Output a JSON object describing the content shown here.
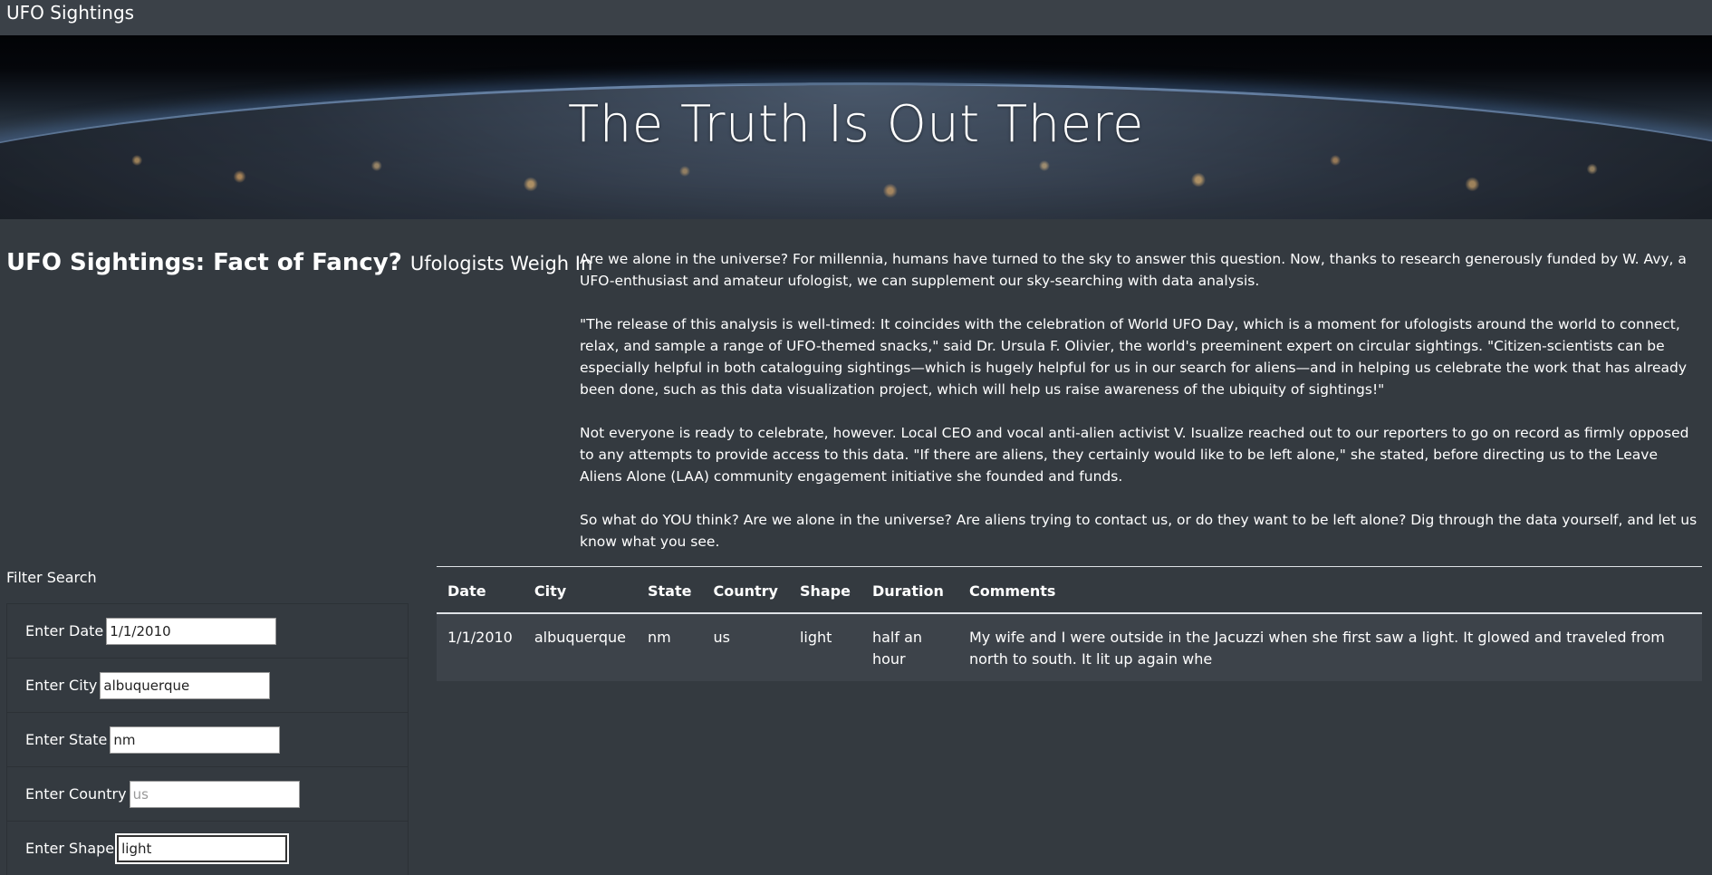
{
  "navbar": {
    "brand": "UFO Sightings"
  },
  "hero": {
    "title": "The Truth Is Out There"
  },
  "headline": {
    "main": "UFO Sightings: Fact of Fancy?",
    "sub": "Ufologists Weigh In"
  },
  "article": {
    "paragraphs": [
      "Are we alone in the universe? For millennia, humans have turned to the sky to answer this question. Now, thanks to research generously funded by W. Avy, a UFO-enthusiast and amateur ufologist, we can supplement our sky-searching with data analysis.",
      "\"The release of this analysis is well-timed: It coincides with the celebration of World UFO Day, which is a moment for ufologists around the world to connect, relax, and sample a range of UFO-themed snacks,\" said Dr. Ursula F. Olivier, the world's preeminent expert on circular sightings. \"Citizen-scientists can be especially helpful in both cataloguing sightings—which is hugely helpful for us in our search for aliens—and in helping us celebrate the work that has already been done, such as this data visualization project, which will help us raise awareness of the ubiquity of sightings!\"",
      "Not everyone is ready to celebrate, however. Local CEO and vocal anti-alien activist V. Isualize reached out to our reporters to go on record as firmly opposed to any attempts to provide access to this data. \"If there are aliens, they certainly would like to be left alone,\" she stated, before directing us to the Leave Aliens Alone (LAA) community engagement initiative she founded and funds.",
      "So what do YOU think? Are we alone in the universe? Are aliens trying to contact us, or do they want to be left alone? Dig through the data yourself, and let us know what you see."
    ]
  },
  "filters": {
    "title": "Filter Search",
    "date": {
      "label": "Enter Date",
      "value": "1/1/2010",
      "placeholder": ""
    },
    "city": {
      "label": "Enter City",
      "value": "albuquerque",
      "placeholder": ""
    },
    "state": {
      "label": "Enter State",
      "value": "nm",
      "placeholder": ""
    },
    "country": {
      "label": "Enter Country",
      "value": "",
      "placeholder": "us"
    },
    "shape": {
      "label": "Enter Shape",
      "value": "light",
      "placeholder": ""
    }
  },
  "table": {
    "headers": [
      "Date",
      "City",
      "State",
      "Country",
      "Shape",
      "Duration",
      "Comments"
    ],
    "rows": [
      [
        "1/1/2010",
        "albuquerque",
        "nm",
        "us",
        "light",
        "half an hour",
        "My wife and I were outside in the Jacuzzi when she first saw a light. It glowed and traveled from north to south. It lit up again whe"
      ]
    ]
  }
}
